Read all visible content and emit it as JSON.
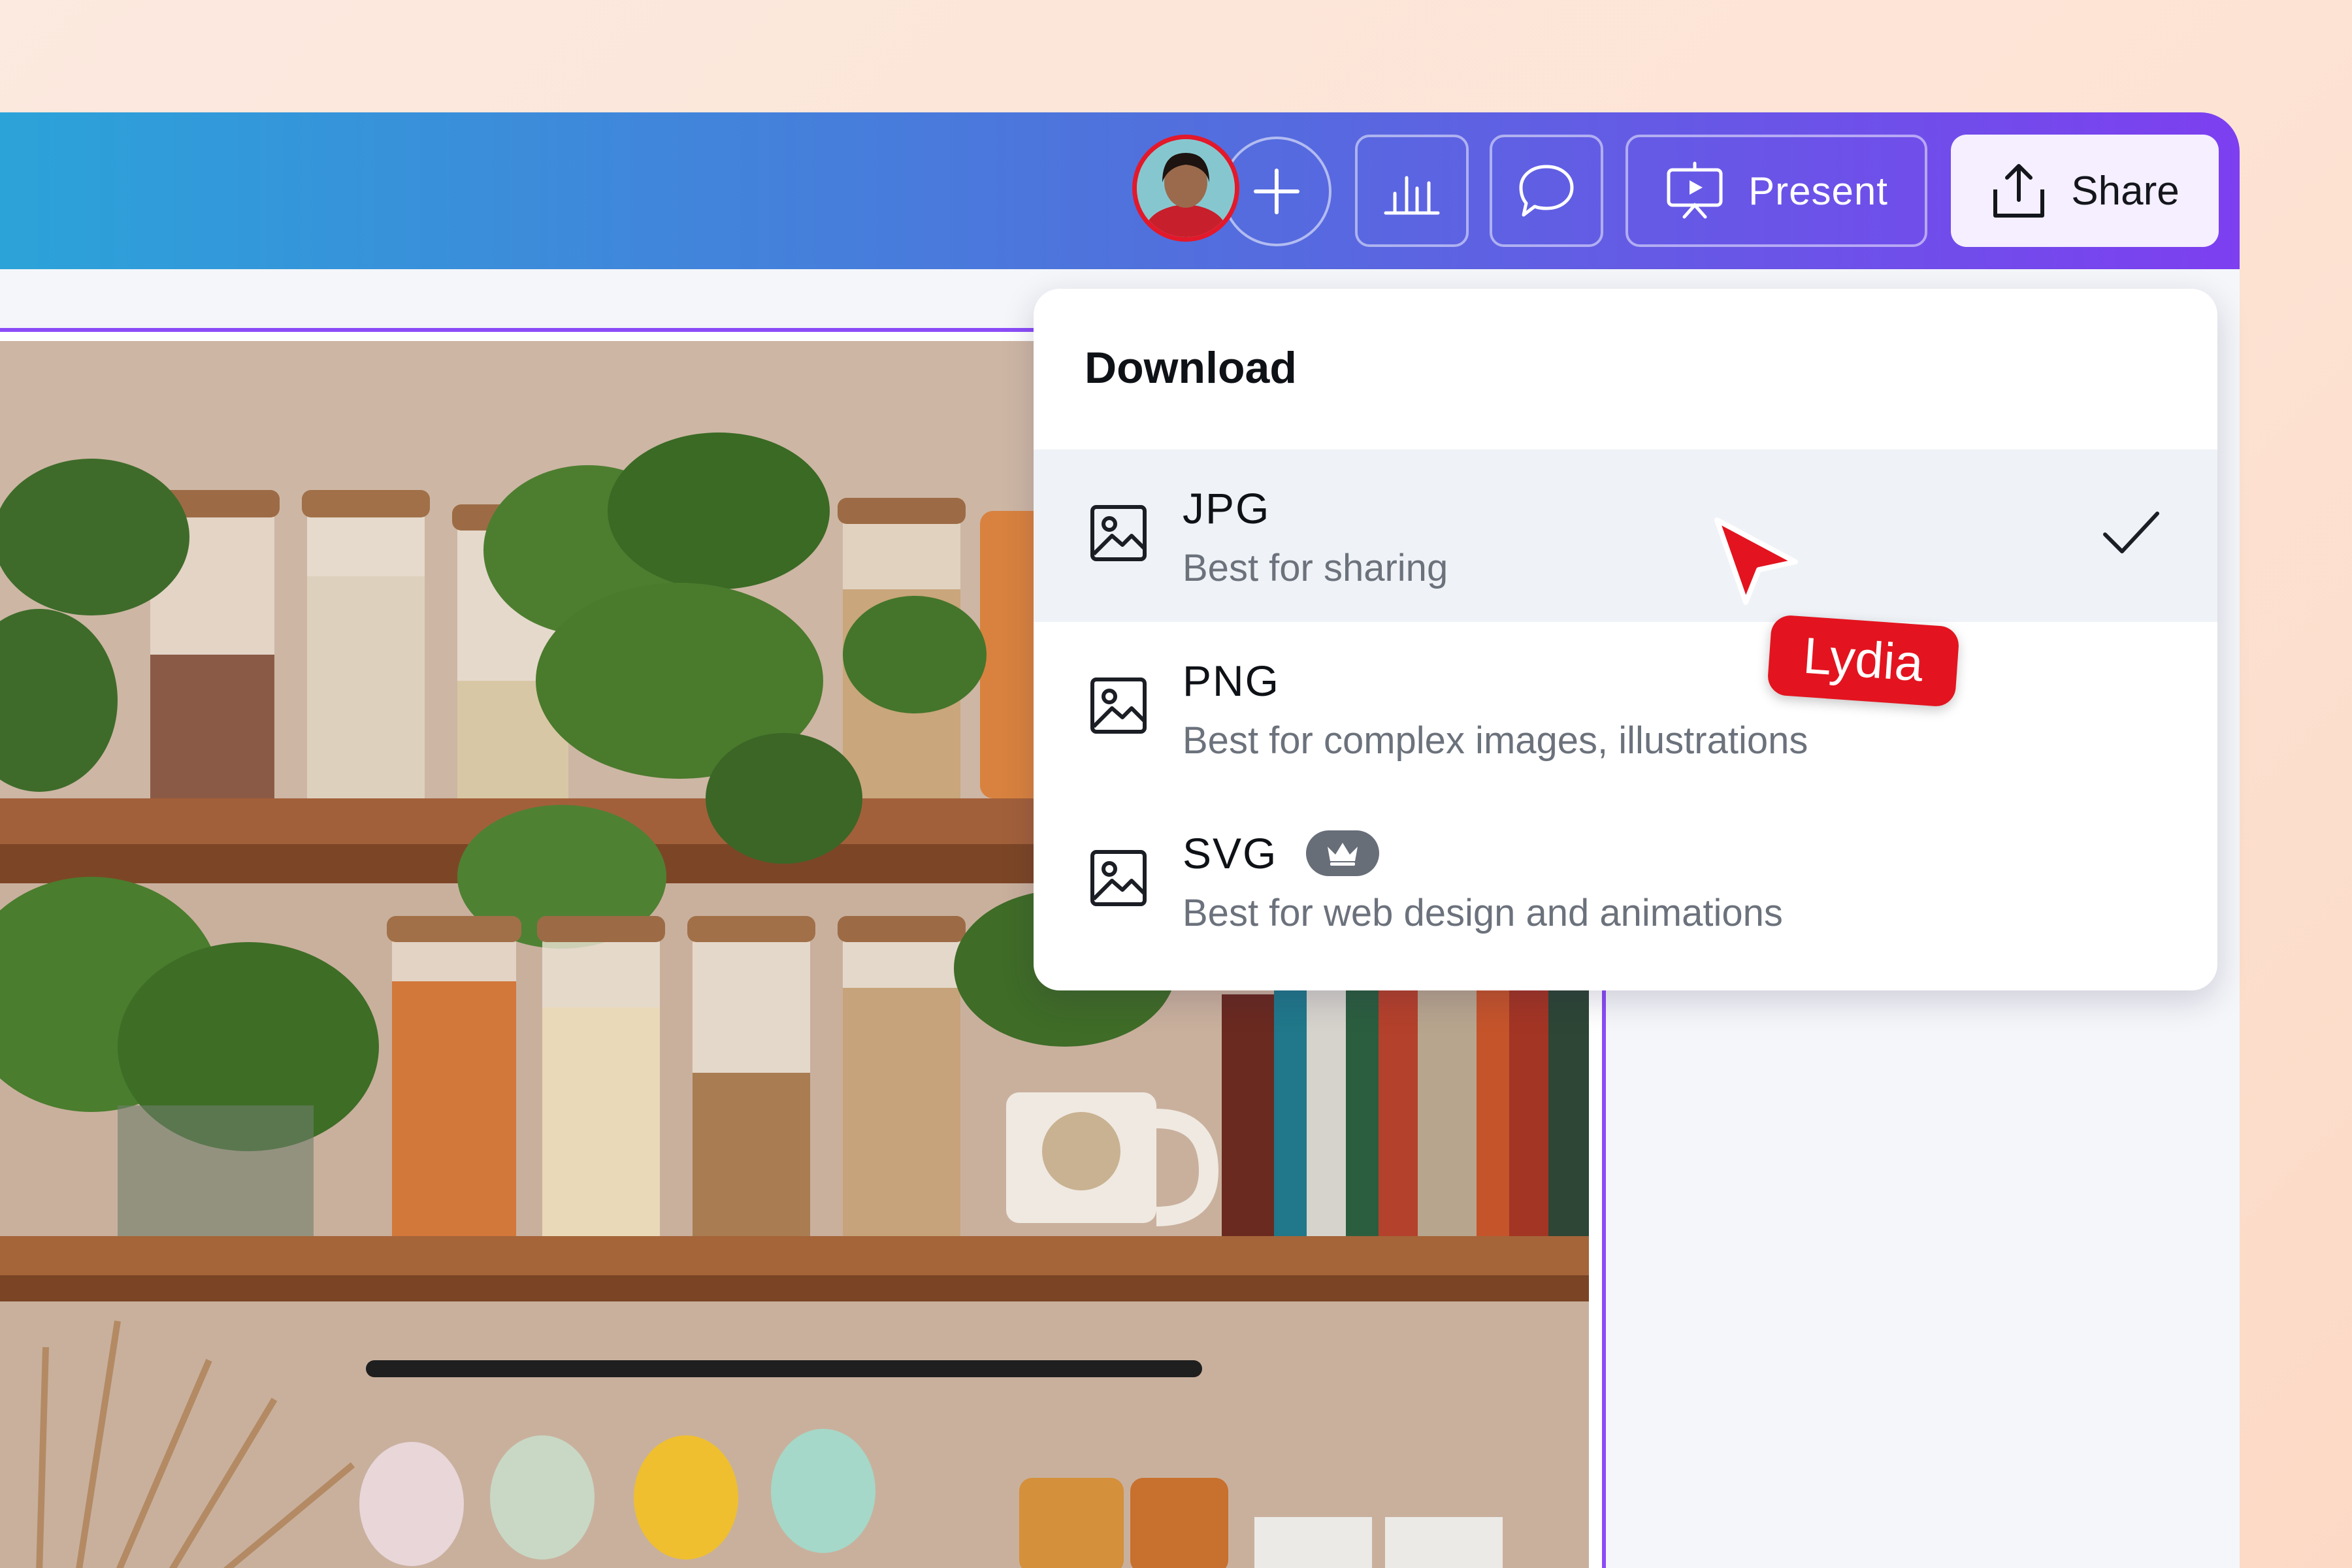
{
  "toolbar": {
    "avatar_alt": "Collaborator avatar",
    "present_label": "Present",
    "share_label": "Share"
  },
  "download_menu": {
    "title": "Download",
    "items": [
      {
        "name": "JPG",
        "description": "Best for sharing",
        "selected": true,
        "icon": "image-icon"
      },
      {
        "name": "PNG",
        "description": "Best for complex images, illustrations",
        "selected": false,
        "icon": "image-icon"
      },
      {
        "name": "SVG",
        "description": "Best for web design and animations",
        "selected": false,
        "pro": true,
        "icon": "image-icon"
      }
    ]
  },
  "collaborator": {
    "name": "Lydia",
    "color": "#e3141f"
  },
  "design": {
    "image_description": "Kitchen shelves with jars, plants, cups and books"
  },
  "colors": {
    "topbar_start": "#2ba3d9",
    "topbar_end": "#7d3ff0",
    "frame_outline": "#8b4cf7",
    "avatar_ring": "#e3182a"
  }
}
